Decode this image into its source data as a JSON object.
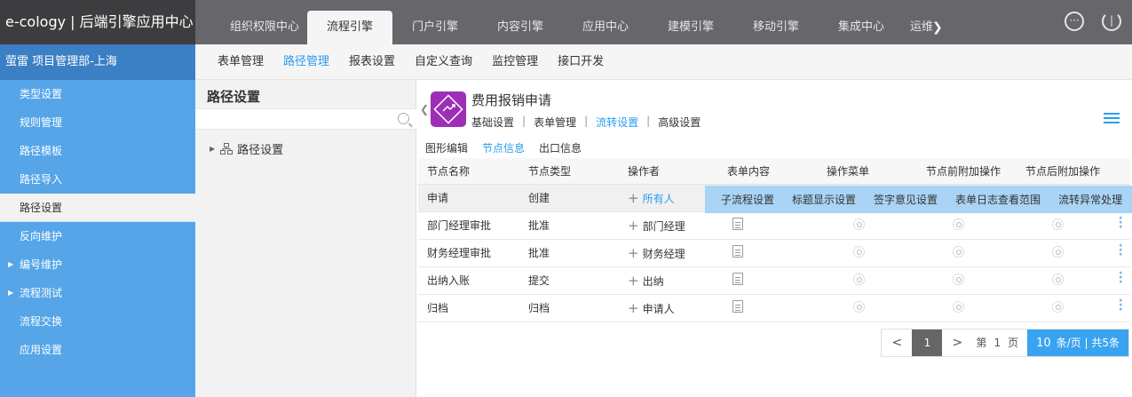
{
  "brand": "e-cology | 后端引擎应用中心",
  "dept": "萤雷   项目管理部-上海",
  "topnav": {
    "tabs": [
      "组织权限中心",
      "流程引擎",
      "门户引擎",
      "内容引擎",
      "应用中心",
      "建模引擎",
      "移动引擎",
      "集成中心",
      "运维"
    ],
    "active_index": 1
  },
  "subnav": {
    "items": [
      "表单管理",
      "路径管理",
      "报表设置",
      "自定义查询",
      "监控管理",
      "接口开发"
    ],
    "active_index": 1
  },
  "sidebar": {
    "items": [
      {
        "label": "类型设置"
      },
      {
        "label": "规则管理"
      },
      {
        "label": "路径模板"
      },
      {
        "label": "路径导入"
      },
      {
        "label": "路径设置",
        "active": true
      },
      {
        "label": "反向维护"
      },
      {
        "label": "编号维护",
        "expandable": true
      },
      {
        "label": "流程测试",
        "expandable": true
      },
      {
        "label": "流程交换"
      },
      {
        "label": "应用设置"
      }
    ]
  },
  "tree": {
    "title": "路径设置",
    "search_placeholder": "",
    "root_node": "路径设置"
  },
  "workflow": {
    "title": "费用报销申请",
    "tabs": [
      "基础设置",
      "表单管理",
      "流转设置",
      "高级设置"
    ],
    "active_tab": 2
  },
  "node_tabs": {
    "items": [
      "图形编辑",
      "节点信息",
      "出口信息"
    ],
    "active_index": 1
  },
  "table": {
    "headers": [
      "节点名称",
      "节点类型",
      "操作者",
      "表单内容",
      "操作菜单",
      "节点前附加操作",
      "节点后附加操作"
    ],
    "rows": [
      {
        "name": "申请",
        "type": "创建",
        "operator": "所有人",
        "selected": true
      },
      {
        "name": "部门经理审批",
        "type": "批准",
        "operator": "部门经理"
      },
      {
        "name": "财务经理审批",
        "type": "批准",
        "operator": "财务经理"
      },
      {
        "name": "出纳入账",
        "type": "提交",
        "operator": "出纳"
      },
      {
        "name": "归档",
        "type": "归档",
        "operator": "申请人"
      }
    ]
  },
  "action_bar": {
    "items": [
      "子流程设置",
      "标题显示设置",
      "签字意见设置",
      "表单日志查看范围",
      "流转异常处理"
    ]
  },
  "pager": {
    "prev": "<",
    "current": "1",
    "next": ">",
    "page_prefix": "第",
    "page_num": "1",
    "page_suffix": "页",
    "page_size": "10",
    "size_suffix": "条/页 | 共5条"
  },
  "colors": {
    "topbar": "#66666b",
    "brand_bg": "#3d3d40",
    "dept_bg": "#3b7fc4",
    "sidebar_bg": "#55a5e8",
    "accent": "#2a9cf0",
    "workflow_icon": "#9c2fb5",
    "action_bar_bg": "#a9d4f5"
  },
  "icons": {
    "more": "more-circle-icon",
    "power": "power-icon",
    "search": "search-icon",
    "tree_node": "org-chart-icon",
    "workflow": "workflow-icon",
    "list": "list-icon",
    "form": "document-icon",
    "menu": "gear-icon",
    "row_more": "vertical-dots-icon"
  }
}
